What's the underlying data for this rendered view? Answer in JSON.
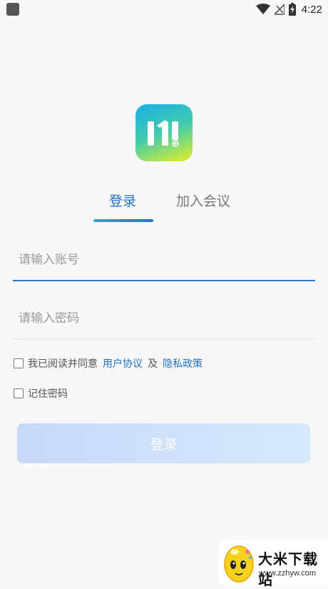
{
  "status_bar": {
    "time": "4:22",
    "icons": [
      "app-notification-icon",
      "wifi-icon",
      "signal-off-icon",
      "battery-charging-icon"
    ]
  },
  "logo": {
    "name": "app-logo",
    "colors": [
      "#1ab0e8",
      "#44cca8",
      "#e6ef2a"
    ]
  },
  "tabs": [
    {
      "label": "登录",
      "active": true
    },
    {
      "label": "加入会议",
      "active": false
    }
  ],
  "form": {
    "account_placeholder": "请输入账号",
    "password_placeholder": "请输入密码",
    "agree_prefix": "我已阅读并同意",
    "user_agreement": "用户协议",
    "and_text": "及",
    "privacy_policy": "隐私政策",
    "remember_password": "记住密码",
    "login_button": "登录"
  },
  "watermark": {
    "title": "大米下载站",
    "url": "www.zzhyw.com"
  },
  "colors": {
    "accent": "#1f72c7",
    "button_start": "#c6d9f8",
    "button_end": "#d6e8fb",
    "background": "#f8f8fa"
  }
}
